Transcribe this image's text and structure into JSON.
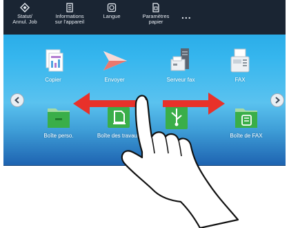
{
  "topbar": {
    "items": [
      {
        "label_line1": "Statut/",
        "label_line2": "Annul. Job",
        "icon": "status-diamond-icon"
      },
      {
        "label_line1": "Informations",
        "label_line2": "sur l'appareil",
        "icon": "device-info-icon"
      },
      {
        "label_line1": "Langue",
        "label_line2": "",
        "icon": "language-icon"
      },
      {
        "label_line1": "Paramètres",
        "label_line2": "papier",
        "icon": "paper-settings-icon"
      }
    ],
    "more": "..."
  },
  "apps": [
    {
      "label": "Copier",
      "icon": "copier-icon"
    },
    {
      "label": "Envoyer",
      "icon": "send-arrow-icon"
    },
    {
      "label": "Serveur fax",
      "icon": "fax-server-icon"
    },
    {
      "label": "FAX",
      "icon": "fax-machine-icon"
    },
    {
      "label": "Boîte perso.",
      "icon": "custom-box-folder-icon"
    },
    {
      "label": "Boîte des travaux",
      "icon": "job-box-icon"
    },
    {
      "label": "",
      "icon": "usb-drive-icon"
    },
    {
      "label": "Boîte de FAX",
      "icon": "fax-box-folder-icon"
    }
  ],
  "colors": {
    "topbar": "#1a2533",
    "screen_top": "#1a9fe0",
    "screen_bottom": "#1d62b0",
    "arrow_red": "#e8312a",
    "green_box": "#3aae49"
  }
}
